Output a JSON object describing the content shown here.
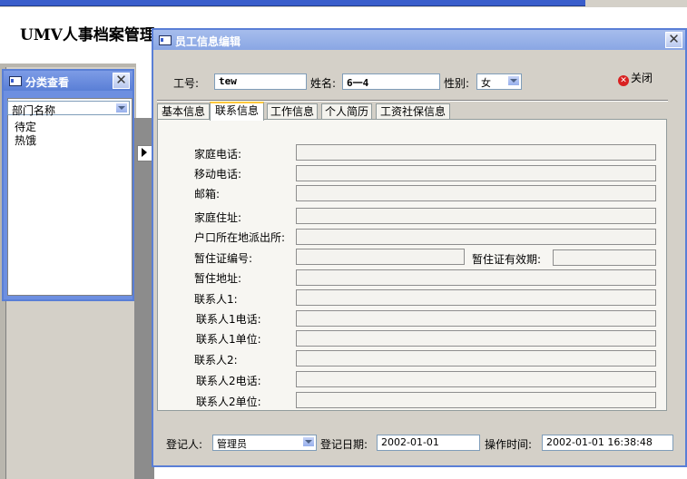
{
  "app": {
    "title": "UMV人事档案管理"
  },
  "category_window": {
    "title": "分类查看",
    "close_label": "✕",
    "filter_value": "部门名称",
    "items": [
      "待定",
      "热饿"
    ]
  },
  "edit_window": {
    "title": "员工信息编辑",
    "close_label": "✕",
    "header": {
      "id_label": "工号:",
      "id_value": "tew",
      "name_label": "姓名:",
      "name_value": "6一4",
      "gender_label": "性别:",
      "gender_value": "女",
      "close_link": "关闭"
    },
    "tabs": [
      {
        "label": "基本信息",
        "active": false
      },
      {
        "label": "联系信息",
        "active": true
      },
      {
        "label": "工作信息",
        "active": false
      },
      {
        "label": "个人简历",
        "active": false
      },
      {
        "label": "工资社保信息",
        "active": false
      }
    ],
    "contact_fields": {
      "home_phone": "家庭电话:",
      "mobile_phone": "移动电话:",
      "email": "邮箱:",
      "home_address": "家庭住址:",
      "hukou_police": "户口所在地派出所:",
      "temp_permit_no": "暂住证编号:",
      "temp_permit_valid": "暂住证有效期:",
      "temp_address": "暂住地址:",
      "contact1": "联系人1:",
      "contact1_phone": "联系人1电话:",
      "contact1_unit": "联系人1单位:",
      "contact2": "联系人2:",
      "contact2_phone": "联系人2电话:",
      "contact2_unit": "联系人2单位:"
    },
    "footer": {
      "registrar_label": "登记人:",
      "registrar_value": "管理员",
      "reg_date_label": "登记日期:",
      "reg_date_value": "2002-01-01",
      "op_time_label": "操作时间:",
      "op_time_value": "2002-01-01 16:38:48"
    }
  },
  "colors": {
    "title_bar": "#7f9fe0",
    "window_border": "#5a7fd6",
    "tab_highlight": "#ffc83c"
  },
  "icons": [
    "form-icon",
    "close-icon",
    "dropdown-arrow-icon",
    "record-pointer-icon"
  ]
}
